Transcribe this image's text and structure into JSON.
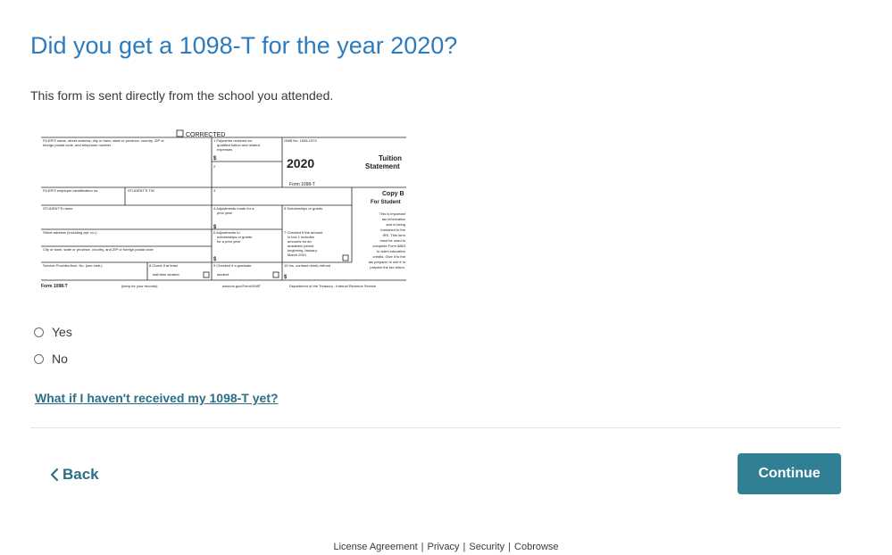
{
  "page": {
    "title": "Did you get a 1098-T for the year 2020?",
    "subtitle": "This form is sent directly from the school you attended."
  },
  "form1098t": {
    "corrected_label": "CORRECTED",
    "filer_label": "FILER'S name, street address, city or town, state or province, country, ZIP or",
    "filer_label2": "foreign postal code, and telephone number",
    "box1_label": "1 Payments received for",
    "box1_label2": "qualified tuition and related",
    "box1_label3": "expenses",
    "omb": "OMB No. 1545-1574",
    "year": "2020",
    "form_name": "Form 1098-T",
    "form_title1": "Tuition",
    "form_title2": "Statement",
    "box2_label": "2",
    "filer_ein_label": "FILER'S employer identification no.",
    "student_tin_label": "STUDENT'S TIN",
    "box3_label": "3",
    "copy_b": "Copy B",
    "for_student": "For Student",
    "student_name_label": "STUDENT'S name",
    "box4_label": "4 Adjustments made for a",
    "box4_label2": "prior year",
    "box5_label": "5 Scholarships or grants",
    "note_lines": [
      "This is important",
      "tax information",
      "and is being",
      "furnished to the",
      "IRS. This form",
      "must be used to",
      "complete Form 8863",
      "to claim education",
      "credits. Give it to the",
      "tax preparer or use it to",
      "prepare the tax return."
    ],
    "street_label": "Street address (including apt. no.)",
    "box6_label": "6 Adjustments to",
    "box6_label2": "scholarships or grants",
    "box6_label3": "for a prior year",
    "box7_label": "7 Checked if the amount",
    "box7_lines": [
      "in box 1 includes",
      "amounts for an",
      "academic period",
      "beginning January-",
      "March 2021"
    ],
    "city_label": "City or town, state or province, country, and ZIP or foreign postal code",
    "provider_label": "Service Provider/Acct. No. (see instr.)",
    "box8_label": "8 Check if at least",
    "box8_label2": "half-time student",
    "box9_label": "9 Checked if a graduate",
    "box9_label2": "student",
    "box10_label": "10 Ins. contract reimb./refund",
    "footer_form": "Form 1098-T",
    "footer_keep": "(keep for your records)",
    "footer_url": "www.irs.gov/Form1098T",
    "footer_dept": "Department of the Treasury - Internal Revenue Service",
    "dollar": "$"
  },
  "options": {
    "yes": "Yes",
    "no": "No"
  },
  "help_link": "What if I haven't received my 1098-T yet?",
  "nav": {
    "back": "Back",
    "continue": "Continue"
  },
  "footer": {
    "license": "License Agreement",
    "privacy": "Privacy",
    "security": "Security",
    "cobrowse": "Cobrowse",
    "separator": "|"
  },
  "colors": {
    "title": "#2c7bbf",
    "link": "#2b6f86",
    "button": "#317f95"
  }
}
